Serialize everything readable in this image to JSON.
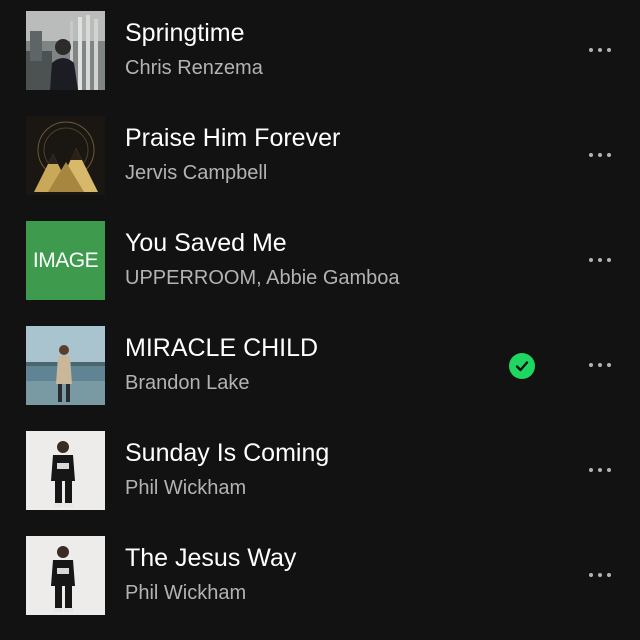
{
  "tracks": [
    {
      "title": "Springtime",
      "artist": "Chris Renzema",
      "artwork_icon": "album-art-springtime",
      "downloaded": false
    },
    {
      "title": "Praise Him Forever",
      "artist": "Jervis Campbell",
      "artwork_icon": "album-art-praise-him-forever",
      "downloaded": false
    },
    {
      "title": "You Saved Me",
      "artist": "UPPERROOM, Abbie Gamboa",
      "artwork_icon": "album-art-you-saved-me",
      "artwork_text": "IMAGE",
      "downloaded": false
    },
    {
      "title": "MIRACLE CHILD",
      "artist": "Brandon Lake",
      "artwork_icon": "album-art-miracle-child",
      "downloaded": true
    },
    {
      "title": "Sunday Is Coming",
      "artist": "Phil Wickham",
      "artwork_icon": "album-art-sunday-is-coming",
      "downloaded": false
    },
    {
      "title": "The Jesus Way",
      "artist": "Phil Wickham",
      "artwork_icon": "album-art-the-jesus-way",
      "downloaded": false
    }
  ],
  "colors": {
    "background": "#121212",
    "title": "#ffffff",
    "artist": "#b3b3b3",
    "downloaded_badge": "#1ed760"
  },
  "icons": {
    "more": "more-options-icon",
    "downloaded": "downloaded-check-icon"
  }
}
